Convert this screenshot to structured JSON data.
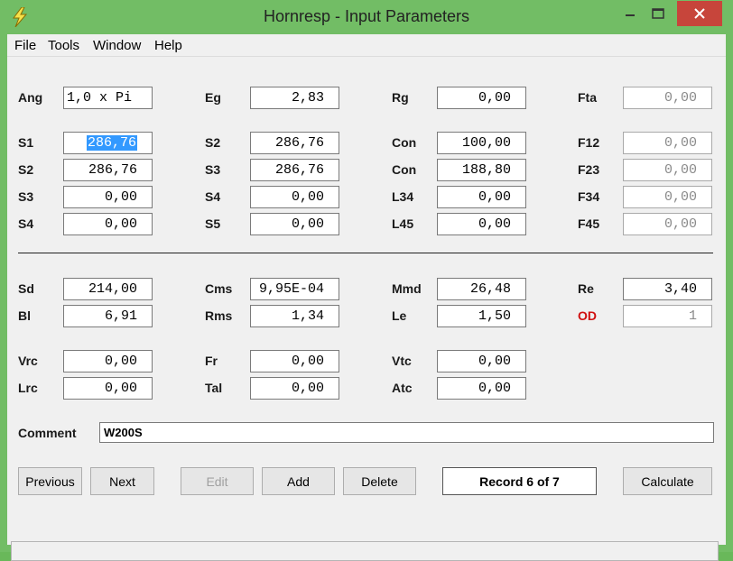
{
  "window": {
    "title": "Hornresp - Input Parameters"
  },
  "menu": [
    "File",
    "Tools",
    "Window",
    "Help"
  ],
  "params": {
    "ang": {
      "label": "Ang",
      "value": "1,0 x Pi"
    },
    "eg": {
      "label": "Eg",
      "value": "2,83"
    },
    "rg": {
      "label": "Rg",
      "value": "0,00"
    },
    "fta": {
      "label": "Fta",
      "value": "0,00"
    },
    "s1": {
      "label": "S1",
      "value": "286,76"
    },
    "s2b": {
      "label": "S2",
      "value": "286,76"
    },
    "con1": {
      "label": "Con",
      "value": "100,00"
    },
    "f12": {
      "label": "F12",
      "value": "0,00"
    },
    "s2": {
      "label": "S2",
      "value": "286,76"
    },
    "s3b": {
      "label": "S3",
      "value": "286,76"
    },
    "con2": {
      "label": "Con",
      "value": "188,80"
    },
    "f23": {
      "label": "F23",
      "value": "0,00"
    },
    "s3": {
      "label": "S3",
      "value": "0,00"
    },
    "s4b": {
      "label": "S4",
      "value": "0,00"
    },
    "l34": {
      "label": "L34",
      "value": "0,00"
    },
    "f34": {
      "label": "F34",
      "value": "0,00"
    },
    "s4": {
      "label": "S4",
      "value": "0,00"
    },
    "s5": {
      "label": "S5",
      "value": "0,00"
    },
    "l45": {
      "label": "L45",
      "value": "0,00"
    },
    "f45": {
      "label": "F45",
      "value": "0,00"
    },
    "sd": {
      "label": "Sd",
      "value": "214,00"
    },
    "cms": {
      "label": "Cms",
      "value": "9,95E-04"
    },
    "mmd": {
      "label": "Mmd",
      "value": "26,48"
    },
    "re": {
      "label": "Re",
      "value": "3,40"
    },
    "bl": {
      "label": "Bl",
      "value": "6,91"
    },
    "rms": {
      "label": "Rms",
      "value": "1,34"
    },
    "le": {
      "label": "Le",
      "value": "1,50"
    },
    "od": {
      "label": "OD",
      "value": "1"
    },
    "vrc": {
      "label": "Vrc",
      "value": "0,00"
    },
    "fr": {
      "label": "Fr",
      "value": "0,00"
    },
    "vtc": {
      "label": "Vtc",
      "value": "0,00"
    },
    "lrc": {
      "label": "Lrc",
      "value": "0,00"
    },
    "tal": {
      "label": "Tal",
      "value": "0,00"
    },
    "atc": {
      "label": "Atc",
      "value": "0,00"
    }
  },
  "comment": {
    "label": "Comment",
    "value": "W200S"
  },
  "buttons": {
    "previous": "Previous",
    "next": "Next",
    "edit": "Edit",
    "add": "Add",
    "delete": "Delete",
    "calculate": "Calculate"
  },
  "record": "Record 6 of 7",
  "colors": {
    "titlebar": "#72bd65",
    "close": "#c7453b",
    "od_label": "#d01010",
    "selection": "#3399ff"
  }
}
